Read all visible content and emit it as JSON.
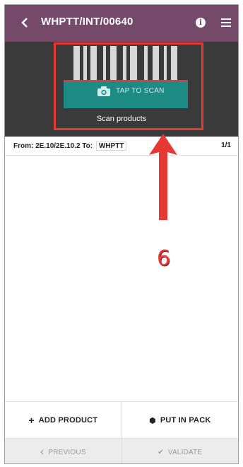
{
  "header": {
    "back_icon": "chevron-left-icon",
    "title": "WHPTT/INT/00640",
    "info_icon": "info-circle-icon",
    "menu_icon": "hamburger-menu-icon",
    "background": "#75496a"
  },
  "scanner": {
    "tap_label": "TAP TO SCAN",
    "caption": "Scan products",
    "camera_icon": "camera-icon",
    "barcode_icon": "barcode-icon"
  },
  "location": {
    "from_label": "From:",
    "from_value": "2E.10/2E.10.2",
    "to_label": "To:",
    "to_value": "WHPTT",
    "count": "1/1"
  },
  "annotation": {
    "step": "6",
    "color": "#e53935"
  },
  "actions": {
    "add_product": "ADD PRODUCT",
    "add_glyph": "+",
    "put_in_pack": "PUT IN PACK",
    "pack_glyph": "⬢"
  },
  "navigation": {
    "previous": "PREVIOUS",
    "previous_glyph": "‹",
    "validate": "VALIDATE",
    "validate_glyph": "✔"
  }
}
